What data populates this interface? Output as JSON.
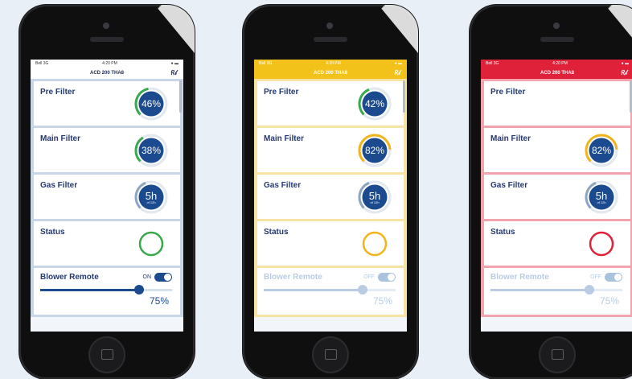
{
  "phones": [
    {
      "theme": "blue",
      "status": {
        "carrier": "Bell 3G",
        "time": "4:20 PM"
      },
      "title": "ACD 200 THA8",
      "pre_filter": {
        "label": "Pre Filter",
        "percent": 46,
        "value_text": "46%",
        "arc_color": "#3aa94d"
      },
      "main_filter": {
        "label": "Main Filter",
        "percent": 38,
        "value_text": "38%",
        "arc_color": "#3aa94d"
      },
      "gas_filter": {
        "label": "Gas Filter",
        "value_text": "5h",
        "sub_text": "of 12h",
        "percent": 42,
        "arc_color": "#8ea5bf"
      },
      "status_card": {
        "label": "Status",
        "ring_color": "#3aa94d"
      },
      "blower": {
        "label": "Blower Remote",
        "toggle_text": "ON",
        "on": true,
        "percent": 75,
        "value_text": "75%"
      }
    },
    {
      "theme": "yellow",
      "status": {
        "carrier": "Bell 3G",
        "time": "4:20 PM"
      },
      "title": "ACD 200 THA8",
      "pre_filter": {
        "label": "Pre Filter",
        "percent": 42,
        "value_text": "42%",
        "arc_color": "#3aa94d"
      },
      "main_filter": {
        "label": "Main Filter",
        "percent": 82,
        "value_text": "82%",
        "arc_color": "#f2b31b"
      },
      "gas_filter": {
        "label": "Gas Filter",
        "value_text": "5h",
        "sub_text": "of 12h",
        "percent": 42,
        "arc_color": "#8ea5bf"
      },
      "status_card": {
        "label": "Status",
        "ring_color": "#f2b31b"
      },
      "blower": {
        "label": "Blower Remote",
        "toggle_text": "OFF",
        "on": false,
        "percent": 75,
        "value_text": "75%"
      }
    },
    {
      "theme": "red",
      "status": {
        "carrier": "Bell 3G",
        "time": "4:20 PM"
      },
      "title": "ACD 200 THA8",
      "pre_filter": {
        "label": "Pre Filter"
      },
      "main_filter": {
        "label": "Main Filter",
        "percent": 82,
        "value_text": "82%",
        "arc_color": "#f2b31b"
      },
      "gas_filter": {
        "label": "Gas Filter",
        "value_text": "5h",
        "sub_text": "of 12h",
        "percent": 42,
        "arc_color": "#8ea5bf"
      },
      "status_card": {
        "label": "Status",
        "ring_color": "#e0213a"
      },
      "blower": {
        "label": "Blower Remote",
        "toggle_text": "OFF",
        "on": false,
        "percent": 75,
        "value_text": "75%"
      }
    }
  ],
  "icons": {
    "logo": "brand-logo-icon",
    "home": "home-button-icon"
  },
  "colors": {
    "navy": "#1c4a8f",
    "label": "#243a73"
  }
}
